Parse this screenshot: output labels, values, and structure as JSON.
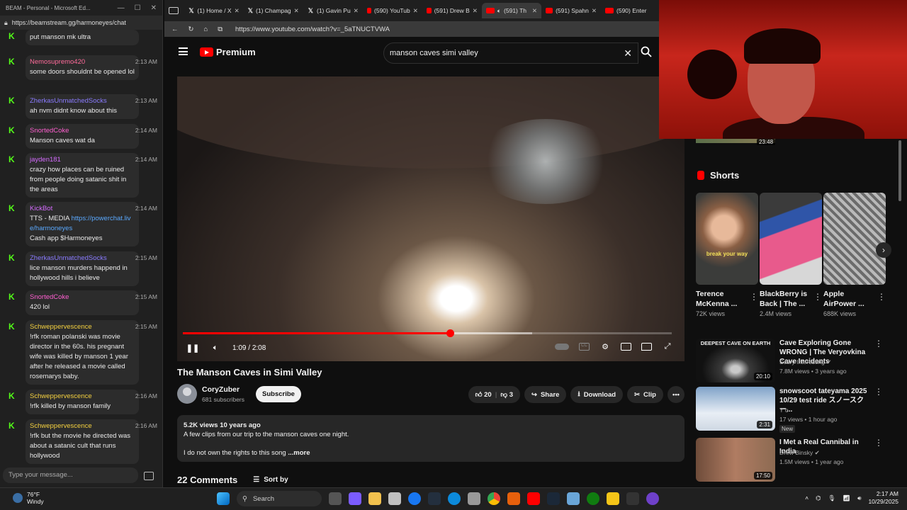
{
  "chat_window": {
    "title": "BEAM - Personal - Microsoft Ed...",
    "url": "https://beamstream.gg/harmoneyes/chat",
    "input_placeholder": "Type your message...",
    "messages": [
      {
        "user": "",
        "time": "",
        "text": "put manson mk ultra",
        "user_color": "#d56bff"
      },
      {
        "user": "Nemosupremo420",
        "time": "2:13 AM",
        "text": "some doors shouldnt be opened lol",
        "user_color": "#ff6b9a"
      },
      {
        "user": "ZherkasUnmatchedSocks",
        "time": "2:13 AM",
        "text": "ah nvm didnt know about this",
        "user_color": "#8a7bff"
      },
      {
        "user": "SnortedCoke",
        "time": "2:14 AM",
        "text": "Manson caves wat da",
        "user_color": "#ff5fd0"
      },
      {
        "user": "jayden181",
        "time": "2:14 AM",
        "text": "crazy how places can be ruined from people doing satanic shit in the areas",
        "user_color": "#d56bff"
      },
      {
        "user": "KickBot",
        "time": "2:14 AM",
        "text_pre": "TTS - MEDIA ",
        "link": "https://powerchat.live/harmoneyes",
        "text_post": "Cash app $Harmoneyes",
        "user_color": "#d56bff"
      },
      {
        "user": "ZherkasUnmatchedSocks",
        "time": "2:15 AM",
        "text": "lice manson murders happend in hollywood hills i believe",
        "user_color": "#8a7bff"
      },
      {
        "user": "SnortedCoke",
        "time": "2:15 AM",
        "text": "420 lol",
        "user_color": "#ff5fd0"
      },
      {
        "user": "Schweppervescence",
        "time": "2:15 AM",
        "text": "!rfk roman polanski was movie director in the 60s. his pregnant wife was killed by manson 1 year after he released a movie called rosemarys baby.",
        "user_color": "#f4d03f"
      },
      {
        "user": "Schweppervescence",
        "time": "2:16 AM",
        "text": "!rfk killed by manson family",
        "user_color": "#f4d03f"
      },
      {
        "user": "Schweppervescence",
        "time": "2:16 AM",
        "text": "!rfk but the movie he directed was about a satanic cult that runs hollywood",
        "user_color": "#f4d03f"
      }
    ]
  },
  "browser": {
    "tabs": [
      {
        "label": "(1) Home / X",
        "icon": "x-icon"
      },
      {
        "label": "(1) Champag",
        "icon": "x-icon"
      },
      {
        "label": "(1) Gavin Pu",
        "icon": "x-icon"
      },
      {
        "label": "(590) YouTub",
        "icon": "youtube-icon"
      },
      {
        "label": "(591) Drew B",
        "icon": "youtube-icon"
      },
      {
        "label": "(591) Th",
        "icon": "youtube-icon",
        "active": true
      },
      {
        "label": "(591) Spahn",
        "icon": "youtube-icon"
      },
      {
        "label": "(590) Enter",
        "icon": "youtube-icon"
      }
    ],
    "url": "https://www.youtube.com/watch?v=_5aTNUCTVWA"
  },
  "youtube": {
    "logo": "Premium",
    "search_query": "manson caves simi valley",
    "player": {
      "time_current": "1:09",
      "time_total": "2:08",
      "played_fraction": 0.547,
      "buffered_fraction": 0.715
    },
    "video_title": "The Manson Caves in Simi Valley",
    "channel": {
      "name": "CoryZuber",
      "subscribers": "681 subscribers"
    },
    "subscribe_label": "Subscribe",
    "likes": "20",
    "dislikes": "3",
    "share_label": "Share",
    "download_label": "Download",
    "clip_label": "Clip",
    "description": {
      "meta": "5.2K views  10 years ago",
      "line1": "A few clips from our trip to the manson caves one night.",
      "line2": "I do not own the rights to this song",
      "more": "...more"
    },
    "comments_label": "22 Comments",
    "sort_label": "Sort by",
    "top_duration": "23:48",
    "shorts_heading": "Shorts",
    "shorts": [
      {
        "title": "Terence McKenna ...",
        "views": "72K views",
        "overlay": "break your way"
      },
      {
        "title": "BlackBerry is Back | The ...",
        "views": "2.4M views"
      },
      {
        "title": "Apple AirPower ...",
        "views": "688K views"
      }
    ],
    "recommendations": [
      {
        "title": "Cave Exploring Gone WRONG | The Veryovkina Cave Incidents",
        "channel": "Scary Interesting",
        "meta": "7.8M views • 3 years ago",
        "duration": "20:10",
        "thumb_text": "DEEPEST CAVE ON EARTH",
        "verified": true
      },
      {
        "title": "snowscoot tateyama 2025 10/29 test ride スノースクー...",
        "channel": "Y o",
        "meta": "17 views • 1 hour ago",
        "duration": "2:31",
        "badge": "New"
      },
      {
        "title": "I Met a Real Cannibal in India",
        "channel": "Drew Binsky",
        "meta": "1.5M views • 1 year ago",
        "duration": "17:50",
        "verified": true
      }
    ]
  },
  "taskbar": {
    "temp": "76°F",
    "weather": "Windy",
    "search_label": "Search",
    "time": "2:17 AM",
    "date": "10/29/2025"
  }
}
